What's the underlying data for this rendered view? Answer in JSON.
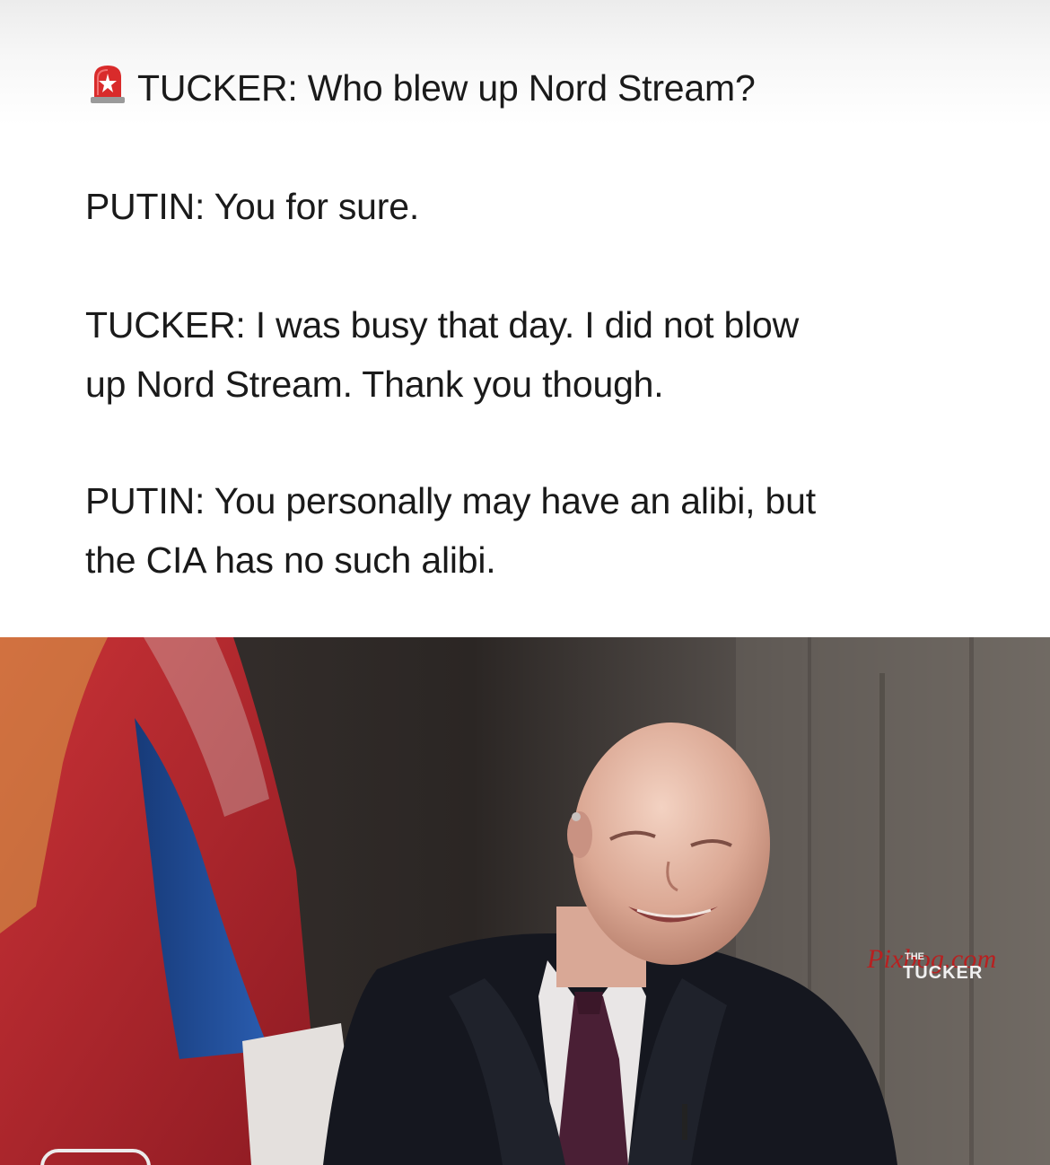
{
  "post": {
    "alert_icon": "rotating-light-icon",
    "lines": [
      "TUCKER: Who blew up Nord Stream?",
      "PUTIN: You for sure.",
      "TUCKER: I was busy that day. I did not blow",
      "up Nord Stream. Thank you though.",
      "PUTIN: You personally may have an alibi, but",
      "the CIA has no such alibi."
    ]
  },
  "photo": {
    "watermark": "Pixbog.com",
    "show_logo_small": "THE",
    "show_logo_name": "TUCKER",
    "colors": {
      "flag_red": "#b8222a",
      "flag_blue": "#1f4f99",
      "suit": "#15171f",
      "tie": "#4a1f35"
    }
  }
}
